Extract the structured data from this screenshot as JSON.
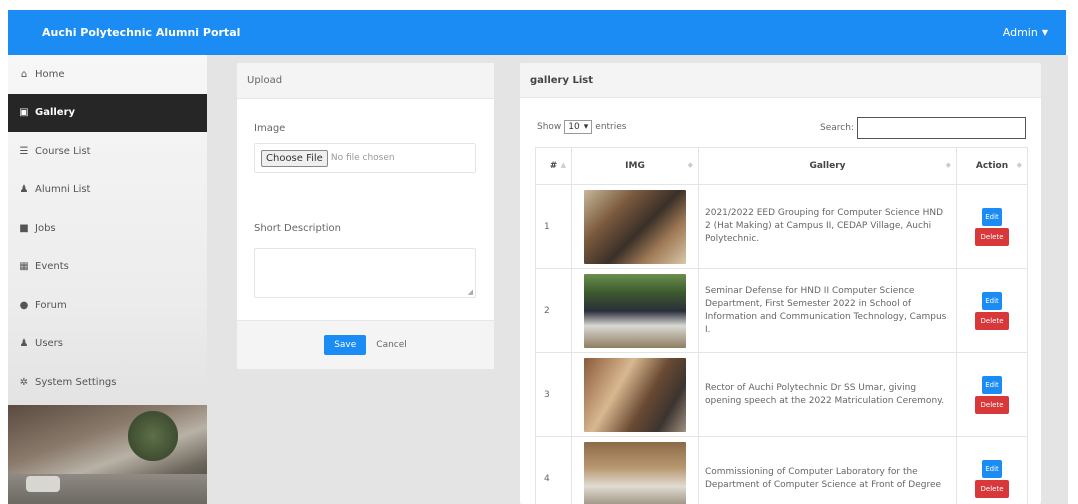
{
  "app": {
    "brand": "Auchi Polytechnic Alumni Portal",
    "user_menu": "Admin"
  },
  "sidebar": {
    "items": [
      {
        "label": "Home",
        "icon": "home-icon",
        "active": false
      },
      {
        "label": "Gallery",
        "icon": "gallery-icon",
        "active": true
      },
      {
        "label": "Course List",
        "icon": "list-icon",
        "active": false
      },
      {
        "label": "Alumni List",
        "icon": "users-icon",
        "active": false
      },
      {
        "label": "Jobs",
        "icon": "briefcase-icon",
        "active": false
      },
      {
        "label": "Events",
        "icon": "calendar-icon",
        "active": false
      },
      {
        "label": "Forum",
        "icon": "comments-icon",
        "active": false
      },
      {
        "label": "Users",
        "icon": "users-icon",
        "active": false
      },
      {
        "label": "System Settings",
        "icon": "gears-icon",
        "active": false
      }
    ]
  },
  "upload": {
    "title": "Upload",
    "image_label": "Image",
    "file_button": "Choose File",
    "file_status": "No file chosen",
    "description_label": "Short Description",
    "save": "Save",
    "cancel": "Cancel"
  },
  "gallery": {
    "title": "gallery List",
    "show": "Show",
    "entries_value": "10",
    "entries": "entries",
    "search_label": "Search:",
    "columns": [
      "#",
      "IMG",
      "Gallery",
      "Action"
    ],
    "rows": [
      {
        "num": "1",
        "desc": "2021/2022 EED Grouping for Computer Science HND 2 (Hat Making) at Campus II, CEDAP Village, Auchi Polytechnic."
      },
      {
        "num": "2",
        "desc": "Seminar Defense for HND II Computer Science Department, First Semester 2022 in School of Information and Communication Technology, Campus I."
      },
      {
        "num": "3",
        "desc": "Rector of Auchi Polytechnic Dr SS Umar, giving opening speech at the 2022 Matriculation Ceremony."
      },
      {
        "num": "4",
        "desc": "Commissioning of Computer Laboratory for the Department of Computer Science at Front of Degree"
      }
    ],
    "edit": "Edit",
    "delete": "Delete"
  }
}
